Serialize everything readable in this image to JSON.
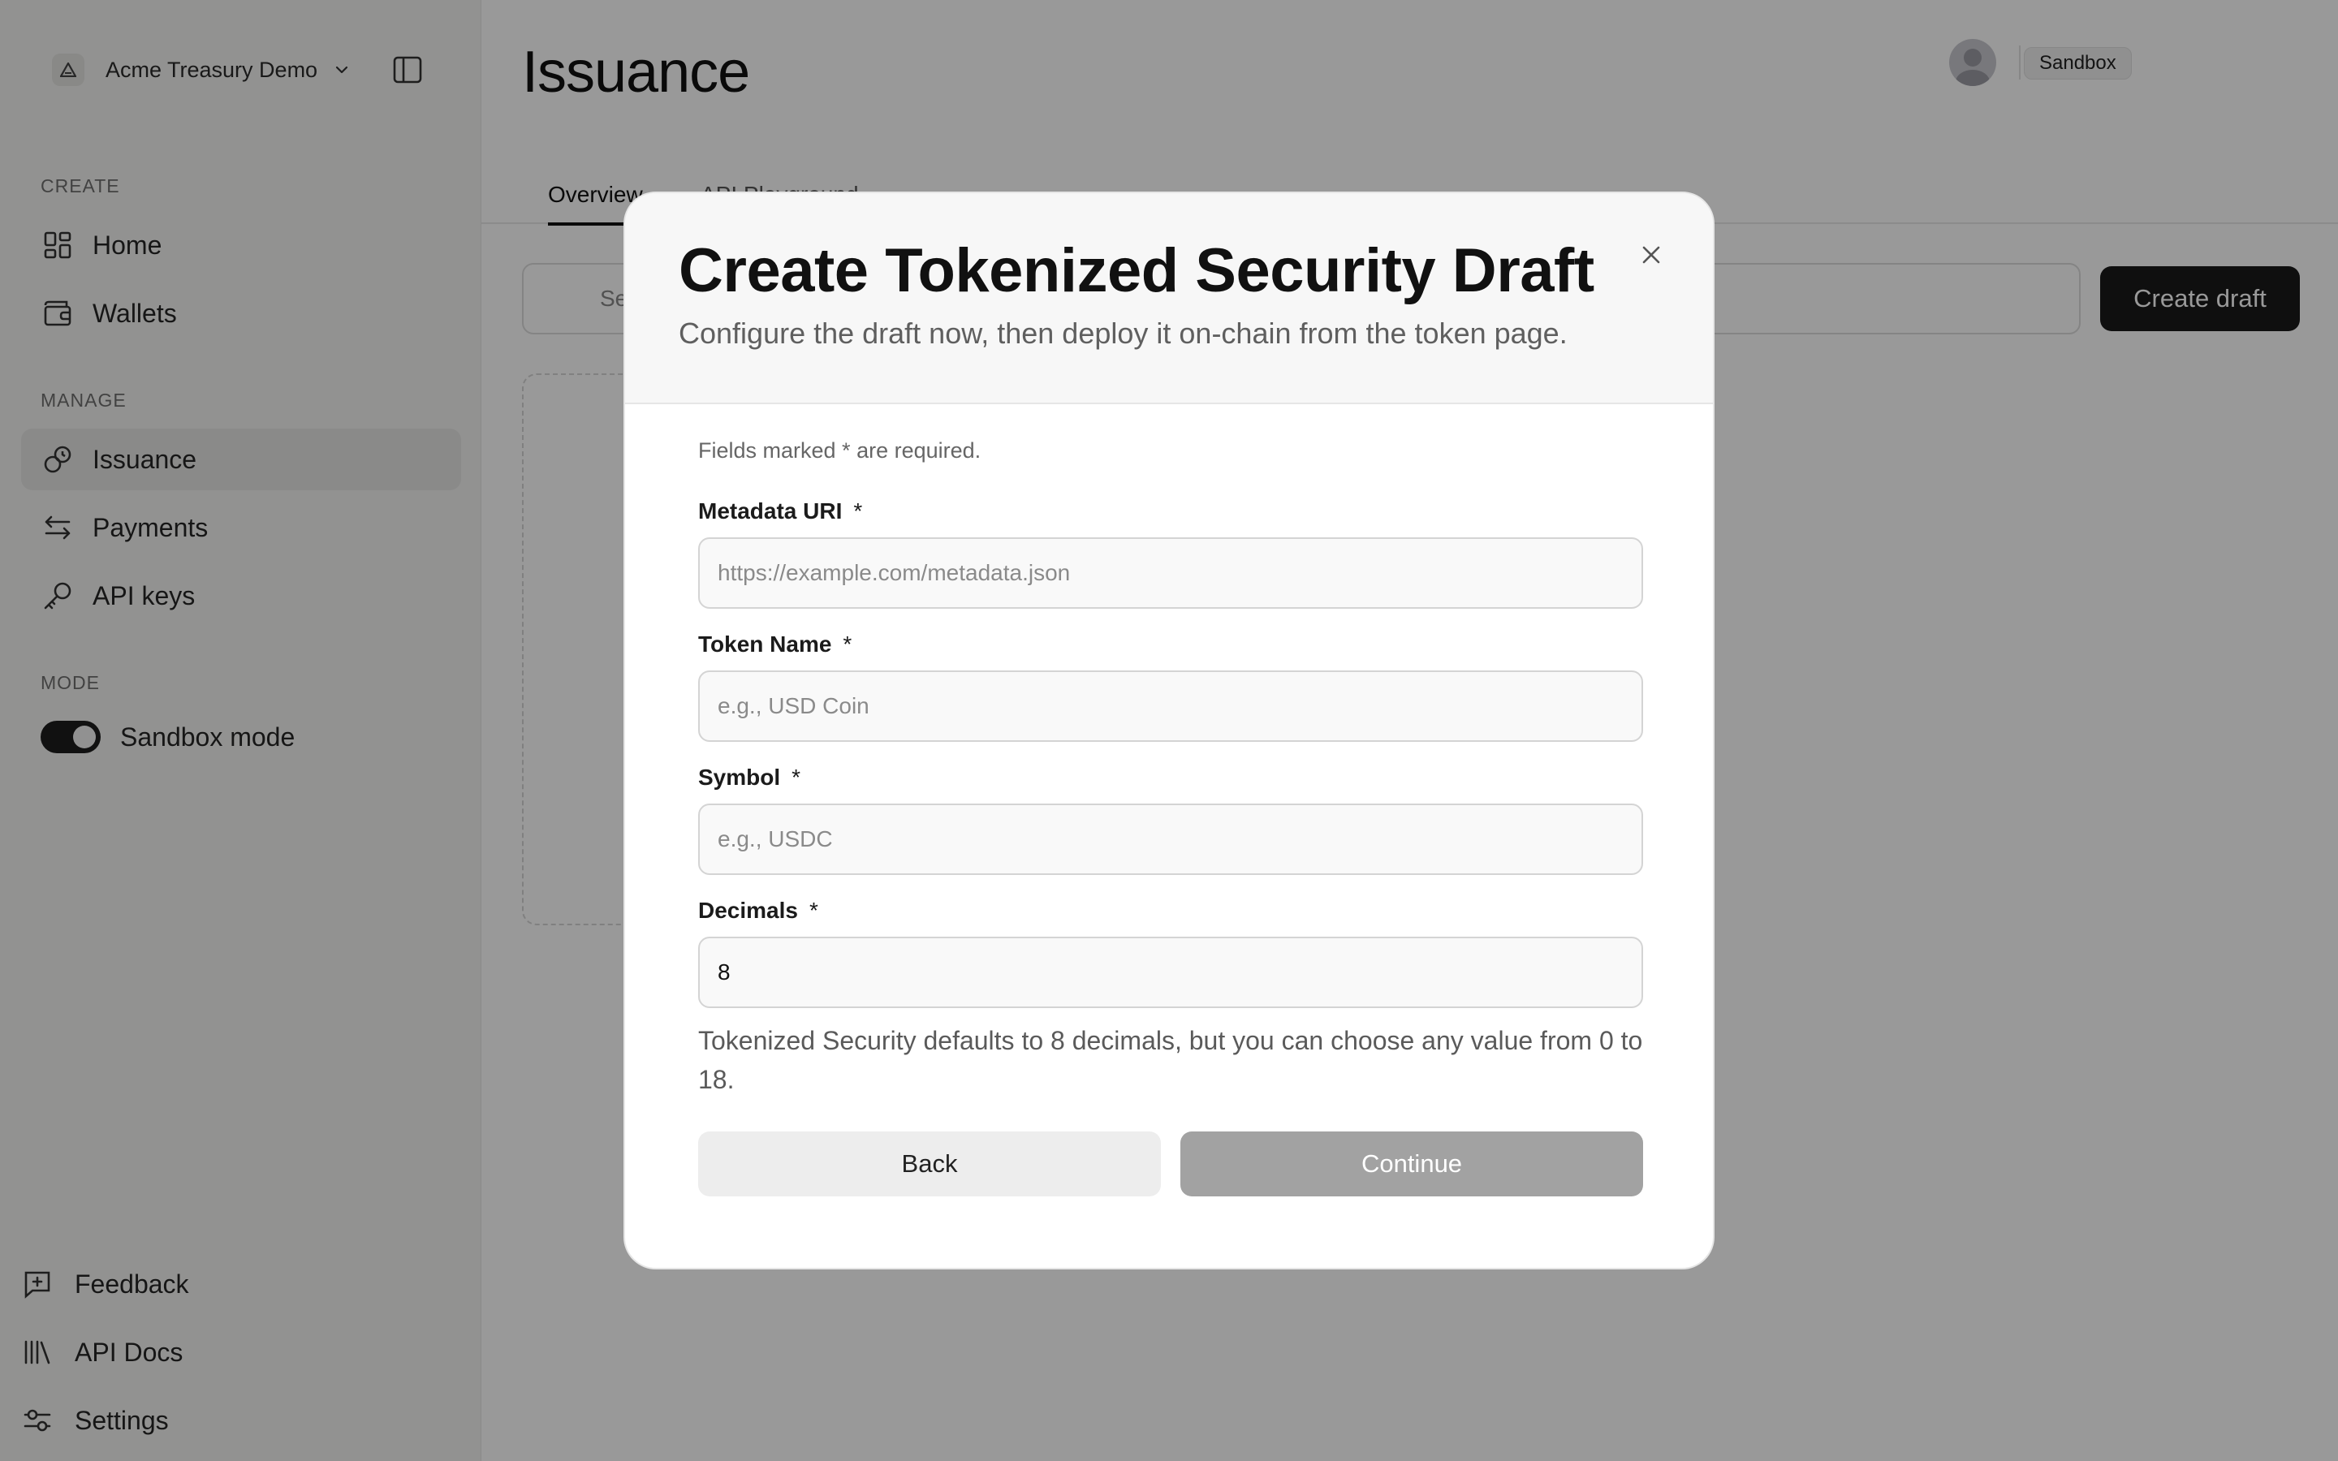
{
  "sidebar": {
    "org_name": "Acme Treasury Demo",
    "sections": {
      "create": "CREATE",
      "manage": "MANAGE",
      "mode": "MODE"
    },
    "items": [
      {
        "label": "Home",
        "icon": "grid-icon"
      },
      {
        "label": "Wallets",
        "icon": "wallet-icon"
      },
      {
        "label": "Issuance",
        "icon": "issuance-icon",
        "active": true
      },
      {
        "label": "Payments",
        "icon": "arrows-icon"
      },
      {
        "label": "API keys",
        "icon": "key-icon"
      }
    ],
    "mode_toggle": {
      "label": "Sandbox mode",
      "on": true
    },
    "footer": [
      {
        "label": "Feedback",
        "icon": "feedback-icon"
      },
      {
        "label": "API Docs",
        "icon": "library-icon"
      },
      {
        "label": "Settings",
        "icon": "sliders-icon"
      }
    ]
  },
  "header": {
    "title": "Issuance",
    "env_badge": "Sandbox"
  },
  "tabs": [
    {
      "label": "Overview",
      "active": true
    },
    {
      "label": "API Playground"
    }
  ],
  "toolbar": {
    "search_placeholder": "Se",
    "create_label": "Create draft"
  },
  "modal": {
    "title": "Create Tokenized Security Draft",
    "subtitle": "Configure the draft now, then deploy it on-chain from the token page.",
    "required_note": "Fields marked * are required.",
    "required_marker": "*",
    "fields": {
      "metadata_uri": {
        "label": "Metadata URI",
        "placeholder": "https://example.com/metadata.json",
        "value": ""
      },
      "token_name": {
        "label": "Token Name",
        "placeholder": "e.g., USD Coin",
        "value": ""
      },
      "symbol": {
        "label": "Symbol",
        "placeholder": "e.g., USDC",
        "value": ""
      },
      "decimals": {
        "label": "Decimals",
        "placeholder": "",
        "value": "8"
      }
    },
    "helper_text": "Tokenized Security defaults to 8 decimals, but you can choose any value from 0 to 18.",
    "back_label": "Back",
    "continue_label": "Continue"
  },
  "colors": {
    "primary": "#1a1a1a",
    "overlay": "rgba(0,0,0,0.4)",
    "disabled_button": "#a2a2a2"
  }
}
